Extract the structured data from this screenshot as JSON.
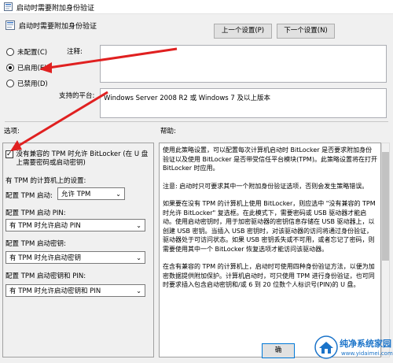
{
  "window": {
    "title": "启动时需要附加身份验证",
    "icon": "policy-icon"
  },
  "header": {
    "title": "启动时需要附加身份验证",
    "icon": "policy-icon"
  },
  "toolbar": {
    "prev_label": "上一个设置(P)",
    "next_label": "下一个设置(N)"
  },
  "state_options": [
    {
      "label": "未配置(C)",
      "checked": false
    },
    {
      "label": "已启用(E)",
      "checked": true
    },
    {
      "label": "已禁用(D)",
      "checked": false
    }
  ],
  "comment": {
    "label": "注释:",
    "value": ""
  },
  "platform": {
    "label": "支持的平台:",
    "value": "Windows Server 2008 R2 或 Windows 7 及以上版本"
  },
  "options": {
    "section_label": "选项:",
    "allow_no_tpm": {
      "label": "没有兼容的 TPM 时允许 BitLocker (在 U 盘上需要密码或启动密钥)",
      "checked": true
    },
    "tpm_computer_label": "有 TPM 的计算机上的设置:",
    "tpm_startup": {
      "label": "配置 TPM 启动:",
      "value": "允许 TPM"
    },
    "tpm_pin": {
      "label": "配置 TPM 启动 PIN:",
      "value": "有 TPM 时允许启动 PIN"
    },
    "tpm_key": {
      "label": "配置 TPM 启动密钥:",
      "value": "有 TPM 时允许启动密钥"
    },
    "tpm_key_pin": {
      "label": "配置 TPM 启动密钥和 PIN:",
      "value": "有 TPM 时允许启动密钥和 PIN"
    }
  },
  "help": {
    "section_label": "帮助:",
    "paragraphs": [
      "使用此策略设置，可以配置每次计算机启动时 BitLocker 是否要求附加身份验证以及使用 BitLocker 是否带受信任平台模块(TPM)。此策略设置将在打开 BitLocker 时应用。",
      "注意: 启动时只可要求其中一个附加身份验证选项，否则会发生策略错误。",
      "如果要在没有 TPM 的计算机上使用 BitLocker，则应选中 \"没有兼容的 TPM 时允许 BitLocker\" 复选框。在此模式下，需要密码或 USB 驱动器才能启动。使用启动密钥时，用于加密驱动器的密钥信息存储在 USB 驱动器上，以创建 USB 密钥。当插入 USB 密钥时，对该驱动器的访问将通过身份验证，驱动器处于可访问状态。如果 USB 密钥丢失或不可用，或者忘记了密码，则需要使用其中一个 BitLocker 恢复选项才能访问该驱动器。",
      "在含有兼容的 TPM 的计算机上，启动时可使用四种身份验证方法，以便为加密数据提供附加保护。计算机启动时，可只使用 TPM 进行身份验证，也可同时要求插入包含启动密钥和/或 6 到 20 位数个人标识号(PIN)的 U 盘。"
    ]
  },
  "footer": {
    "ok_label": "确"
  },
  "watermark": {
    "brand": "纯净系统家园",
    "url": "www.yidaimei.com"
  },
  "colors": {
    "annotation_arrow": "#e02020",
    "watermark_blue": "#1a73c9"
  }
}
